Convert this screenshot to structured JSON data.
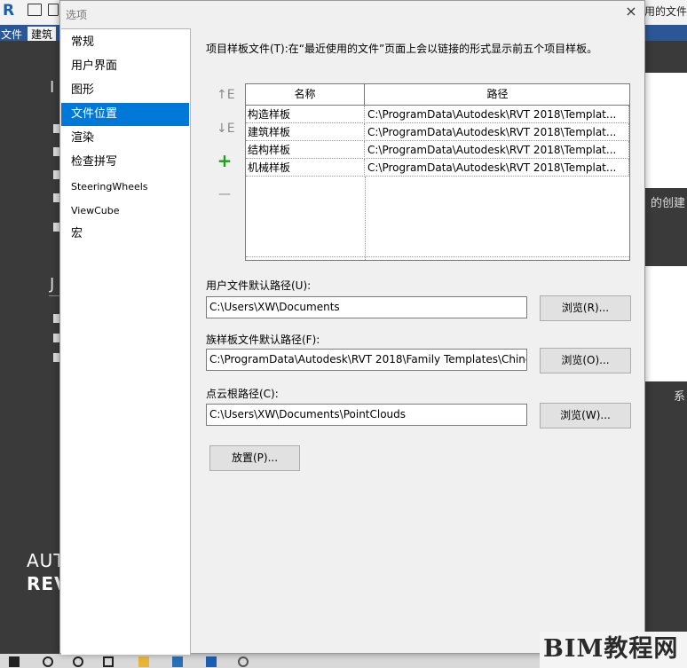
{
  "app": {
    "logo": "R",
    "ribbon_tabs": [
      "文件",
      "建筑"
    ],
    "right_title": "用的文件",
    "card_captions": [
      "的创建",
      "系"
    ],
    "brand_lines": [
      "AUT",
      "REV"
    ]
  },
  "dialog": {
    "title": "选项",
    "close": "×"
  },
  "nav": {
    "items": [
      {
        "label": "常规"
      },
      {
        "label": "用户界面"
      },
      {
        "label": "图形"
      },
      {
        "label": "文件位置"
      },
      {
        "label": "渲染"
      },
      {
        "label": "检查拼写"
      },
      {
        "label": "SteeringWheels"
      },
      {
        "label": "ViewCube"
      },
      {
        "label": "宏"
      }
    ],
    "selected": "文件位置"
  },
  "file_locations": {
    "description": "项目样板文件(T):在“最近使用的文件”页面上会以链接的形式显示前五个项目样板。",
    "table": {
      "columns": [
        "名称",
        "路径"
      ],
      "rows": [
        {
          "name": "构造样板",
          "path": "C:\\ProgramData\\Autodesk\\RVT 2018\\Templat..."
        },
        {
          "name": "建筑样板",
          "path": "C:\\ProgramData\\Autodesk\\RVT 2018\\Templat..."
        },
        {
          "name": "结构样板",
          "path": "C:\\ProgramData\\Autodesk\\RVT 2018\\Templat..."
        },
        {
          "name": "机械样板",
          "path": "C:\\ProgramData\\Autodesk\\RVT 2018\\Templat..."
        }
      ]
    },
    "side_buttons": {
      "move_up": "↑E",
      "move_down": "↓E",
      "add": "+",
      "remove": "—"
    },
    "user_path": {
      "label": "用户文件默认路径(U):",
      "value": "C:\\Users\\XW\\Documents",
      "browse": "浏览(R)..."
    },
    "family_path": {
      "label": "族样板文件默认路径(F):",
      "value": "C:\\ProgramData\\Autodesk\\RVT 2018\\Family Templates\\Chine",
      "browse": "浏览(O)..."
    },
    "cloud_path": {
      "label": "点云根路径(C):",
      "value": "C:\\Users\\XW\\Documents\\PointClouds",
      "browse": "浏览(W)..."
    },
    "places_button": "放置(P)..."
  },
  "watermark": "BIM教程网",
  "colors": {
    "selection": "#0078d7",
    "ribbon": "#2b5797",
    "add_icon": "#1e9d1e"
  }
}
